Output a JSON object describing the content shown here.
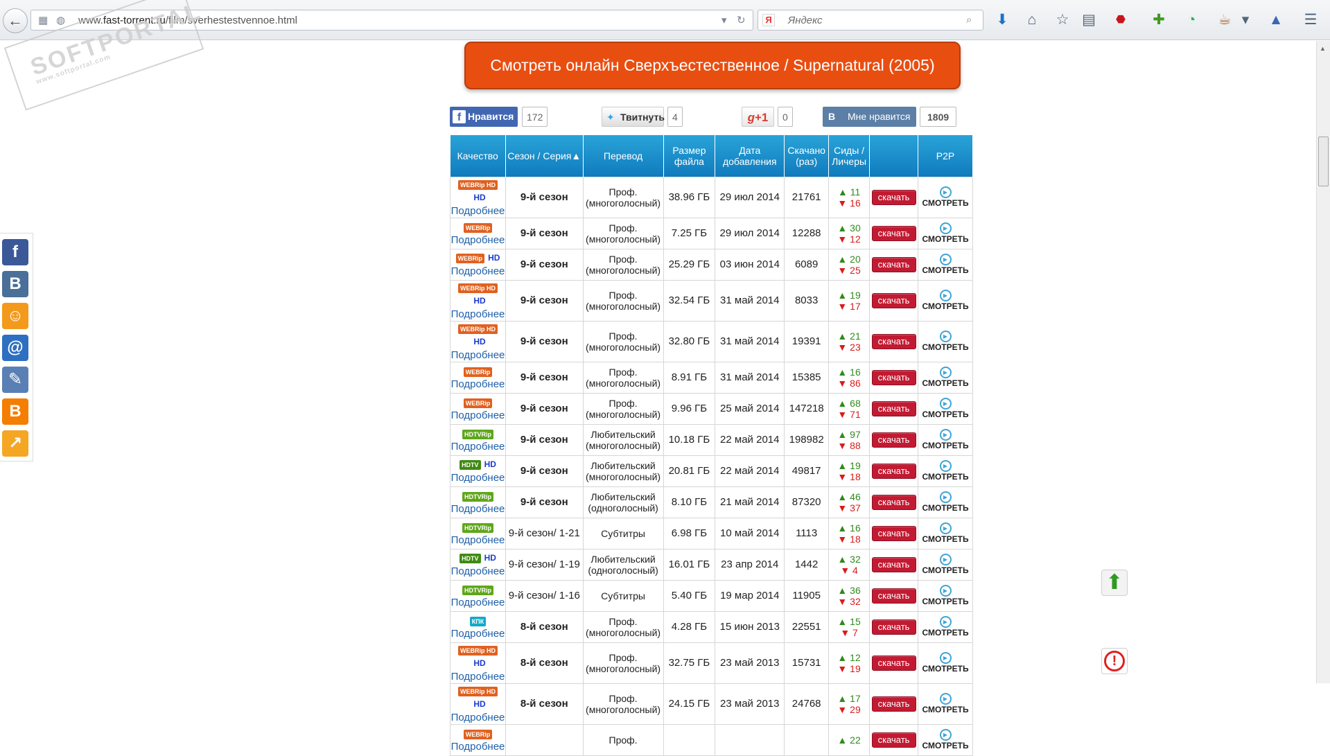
{
  "browser": {
    "url_prefix": "www.",
    "url_domain": "fast-torrent.ru",
    "url_path": "/film/sverhestestvennoe.html",
    "search_placeholder": "Яндекс",
    "search_engine_letter": "Я"
  },
  "watermark": {
    "text": "SOFTPORTAL",
    "sub": "www.softportal.com"
  },
  "watch_button": "Смотреть онлайн Сверхъестественное / Supernatural (2005)",
  "social": {
    "fb_label": "Нравится",
    "fb_count": "172",
    "tw_label": "Твитнуть",
    "tw_count": "4",
    "gplus_label": "+1",
    "gplus_count": "0",
    "vk_label": "Мне нравится",
    "vk_count": "1809"
  },
  "table": {
    "headers": {
      "quality": "Качество",
      "season": "Сезон / Серия▲",
      "translation": "Перевод",
      "size": "Размер файла",
      "date": "Дата добавления",
      "downloads": "Скачано (раз)",
      "seeds": "Сиды / Личеры",
      "p2p": "P2P"
    },
    "more_label": "Подробнее",
    "download_label": "скачать",
    "watch_label": "СМОТРЕТЬ",
    "rows": [
      {
        "badge": "WEBRip HD",
        "badge_color": "#e0611f",
        "hd": true,
        "season": "9-й сезон",
        "bold": true,
        "tr1": "Проф.",
        "tr2": "(многоголосный)",
        "size": "38.96 ГБ",
        "date": "29 июл 2014",
        "dl": "21761",
        "seeds": "▲ 11",
        "leech": "▼ 16"
      },
      {
        "badge": "WEBRip",
        "badge_color": "#e0611f",
        "hd": false,
        "season": "9-й сезон",
        "bold": true,
        "tr1": "Проф.",
        "tr2": "(многоголосный)",
        "size": "7.25 ГБ",
        "date": "29 июл 2014",
        "dl": "12288",
        "seeds": "▲ 30",
        "leech": "▼ 12"
      },
      {
        "badge": "WEBRip",
        "badge_color": "#e0611f",
        "hd": true,
        "season": "9-й сезон",
        "bold": true,
        "tr1": "Проф.",
        "tr2": "(многоголосный)",
        "size": "25.29 ГБ",
        "date": "03 июн 2014",
        "dl": "6089",
        "seeds": "▲ 20",
        "leech": "▼ 25"
      },
      {
        "badge": "WEBRip HD",
        "badge_color": "#e0611f",
        "hd": true,
        "season": "9-й сезон",
        "bold": true,
        "tr1": "Проф.",
        "tr2": "(многоголосный)",
        "size": "32.54 ГБ",
        "date": "31 май 2014",
        "dl": "8033",
        "seeds": "▲ 19",
        "leech": "▼ 17"
      },
      {
        "badge": "WEBRip HD",
        "badge_color": "#e0611f",
        "hd": true,
        "season": "9-й сезон",
        "bold": true,
        "tr1": "Проф.",
        "tr2": "(многоголосный)",
        "size": "32.80 ГБ",
        "date": "31 май 2014",
        "dl": "19391",
        "seeds": "▲ 21",
        "leech": "▼ 23"
      },
      {
        "badge": "WEBRip",
        "badge_color": "#e0611f",
        "hd": false,
        "season": "9-й сезон",
        "bold": true,
        "tr1": "Проф.",
        "tr2": "(многоголосный)",
        "size": "8.91 ГБ",
        "date": "31 май 2014",
        "dl": "15385",
        "seeds": "▲ 16",
        "leech": "▼ 86"
      },
      {
        "badge": "WEBRip",
        "badge_color": "#e0611f",
        "hd": false,
        "season": "9-й сезон",
        "bold": true,
        "tr1": "Проф.",
        "tr2": "(многоголосный)",
        "size": "9.96 ГБ",
        "date": "25 май 2014",
        "dl": "147218",
        "seeds": "▲ 68",
        "leech": "▼ 71"
      },
      {
        "badge": "HDTVRip",
        "badge_color": "#5fa61c",
        "hd": false,
        "season": "9-й сезон",
        "bold": true,
        "tr1": "Любительский",
        "tr2": "(многоголосный)",
        "size": "10.18 ГБ",
        "date": "22 май 2014",
        "dl": "198982",
        "seeds": "▲ 97",
        "leech": "▼ 88"
      },
      {
        "badge": "HDTV",
        "badge_color": "#3f8a12",
        "hd": true,
        "season": "9-й сезон",
        "bold": true,
        "tr1": "Любительский",
        "tr2": "(многоголосный)",
        "size": "20.81 ГБ",
        "date": "22 май 2014",
        "dl": "49817",
        "seeds": "▲ 19",
        "leech": "▼ 18"
      },
      {
        "badge": "HDTVRip",
        "badge_color": "#5fa61c",
        "hd": false,
        "season": "9-й сезон",
        "bold": true,
        "tr1": "Любительский",
        "tr2": "(одноголосный)",
        "size": "8.10 ГБ",
        "date": "21 май 2014",
        "dl": "87320",
        "seeds": "▲ 46",
        "leech": "▼ 37"
      },
      {
        "badge": "HDTVRip",
        "badge_color": "#5fa61c",
        "hd": false,
        "season": "9-й сезон/ 1-21",
        "bold": false,
        "tr1": "Субтитры",
        "tr2": "",
        "size": "6.98 ГБ",
        "date": "10 май 2014",
        "dl": "1113",
        "seeds": "▲ 16",
        "leech": "▼ 18"
      },
      {
        "badge": "HDTV",
        "badge_color": "#3f8a12",
        "hd": true,
        "season": "9-й сезон/ 1-19",
        "bold": false,
        "tr1": "Любительский",
        "tr2": "(одноголосный)",
        "size": "16.01 ГБ",
        "date": "23 апр 2014",
        "dl": "1442",
        "seeds": "▲ 32",
        "leech": "▼ 4"
      },
      {
        "badge": "HDTVRip",
        "badge_color": "#5fa61c",
        "hd": false,
        "season": "9-й сезон/ 1-16",
        "bold": false,
        "tr1": "Субтитры",
        "tr2": "",
        "size": "5.40 ГБ",
        "date": "19 мар 2014",
        "dl": "11905",
        "seeds": "▲ 36",
        "leech": "▼ 32"
      },
      {
        "badge": "КПК",
        "badge_color": "#14a9c9",
        "hd": false,
        "season": "8-й сезон",
        "bold": true,
        "tr1": "Проф.",
        "tr2": "(многоголосный)",
        "size": "4.28 ГБ",
        "date": "15 июн 2013",
        "dl": "22551",
        "seeds": "▲ 15",
        "leech": "▼ 7"
      },
      {
        "badge": "WEBRip HD",
        "badge_color": "#e0611f",
        "hd": true,
        "season": "8-й сезон",
        "bold": true,
        "tr1": "Проф.",
        "tr2": "(многоголосный)",
        "size": "32.75 ГБ",
        "date": "23 май 2013",
        "dl": "15731",
        "seeds": "▲ 12",
        "leech": "▼ 19"
      },
      {
        "badge": "WEBRip HD",
        "badge_color": "#e0611f",
        "hd": true,
        "season": "8-й сезон",
        "bold": true,
        "tr1": "Проф.",
        "tr2": "(многоголосный)",
        "size": "24.15 ГБ",
        "date": "23 май 2013",
        "dl": "24768",
        "seeds": "▲ 17",
        "leech": "▼ 29"
      },
      {
        "badge": "WEBRip",
        "badge_color": "#e0611f",
        "hd": false,
        "season": "",
        "bold": true,
        "tr1": "Проф.",
        "tr2": "",
        "size": "",
        "date": "",
        "dl": "",
        "seeds": "▲ 22",
        "leech": ""
      }
    ]
  },
  "side_share": [
    {
      "name": "facebook-share-icon",
      "glyph": "f",
      "color": "#3b5998"
    },
    {
      "name": "vk-share-icon",
      "glyph": "B",
      "color": "#4a6f98"
    },
    {
      "name": "odnoklassniki-share-icon",
      "glyph": "☺",
      "color": "#f39a1d"
    },
    {
      "name": "mailru-share-icon",
      "glyph": "@",
      "color": "#2e6fc1"
    },
    {
      "name": "livejournal-share-icon",
      "glyph": "✎",
      "color": "#5a7fb5"
    },
    {
      "name": "blogger-share-icon",
      "glyph": "B",
      "color": "#f57d00"
    },
    {
      "name": "share-more-icon",
      "glyph": "↗",
      "color": "#f5a623"
    }
  ]
}
